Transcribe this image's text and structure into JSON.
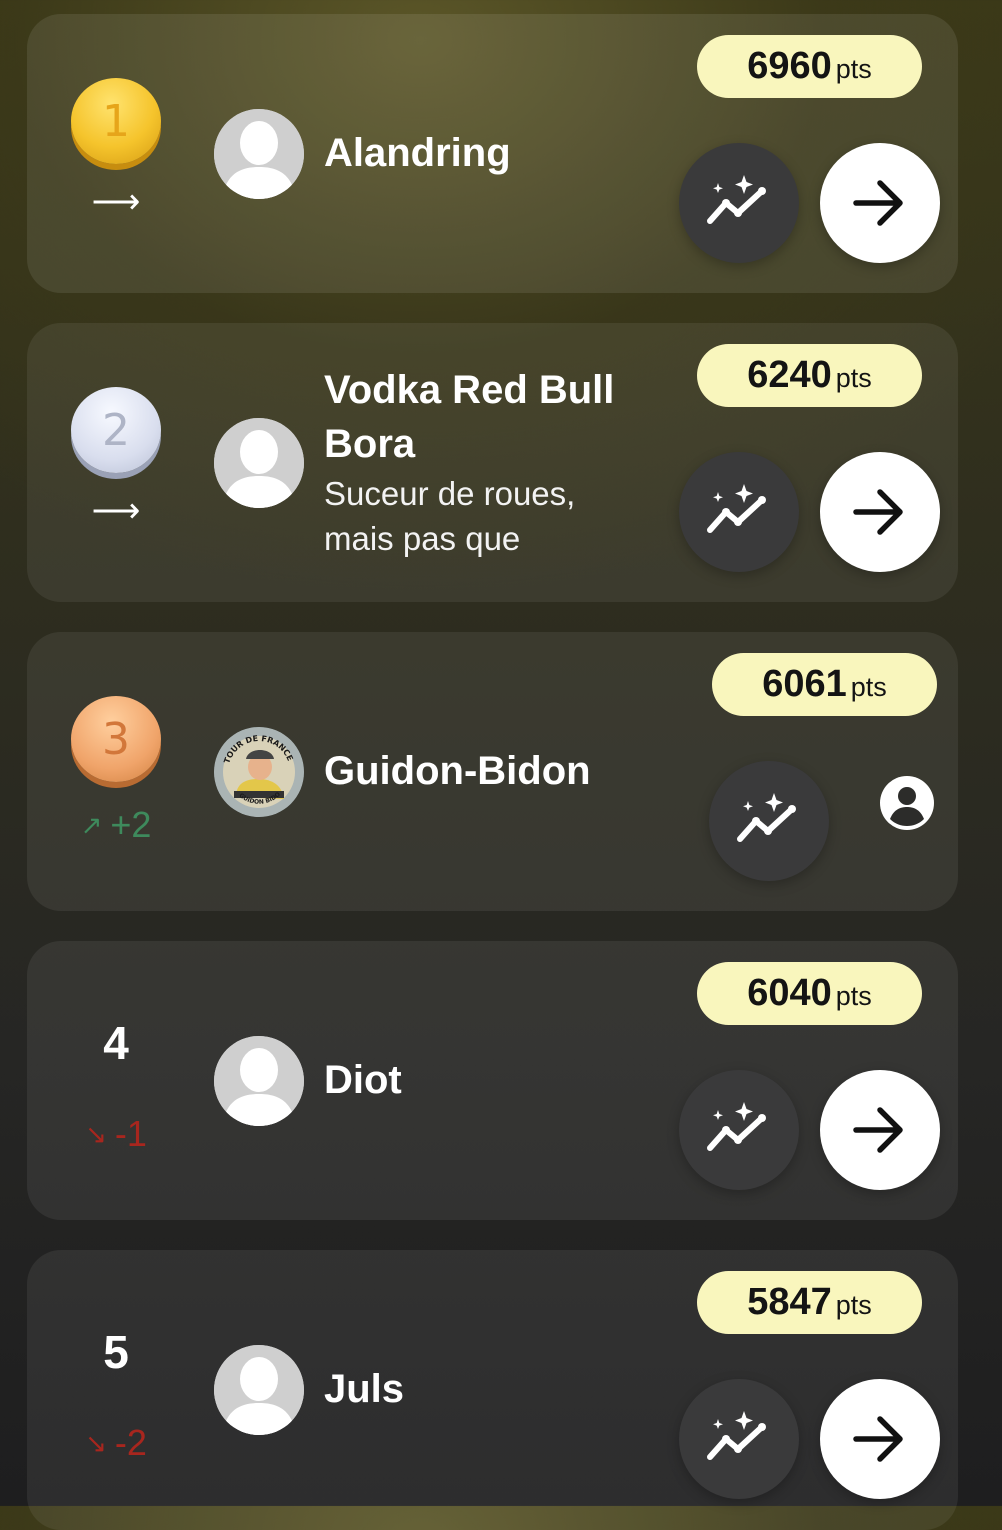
{
  "leaderboard": [
    {
      "rank": "1",
      "medal": "gold",
      "trend_arrow": "⟶",
      "trend_text": "",
      "trend_type": "same",
      "name_line1": "Alandring",
      "name_line2": "",
      "subtitle_line1": "",
      "subtitle_line2": "",
      "points": "6960",
      "points_unit": "pts",
      "avatar": "default-avatar",
      "action": "arrow-right-icon"
    },
    {
      "rank": "2",
      "medal": "silver",
      "trend_arrow": "⟶",
      "trend_text": "",
      "trend_type": "same",
      "name_line1": "Vodka Red Bull",
      "name_line2": "Bora",
      "subtitle_line1": "Suceur de roues,",
      "subtitle_line2": "mais pas que",
      "points": "6240",
      "points_unit": "pts",
      "avatar": "default-avatar",
      "action": "arrow-right-icon"
    },
    {
      "rank": "3",
      "medal": "bronze",
      "trend_arrow": "↗",
      "trend_text": "+2",
      "trend_type": "up",
      "name_line1": "Guidon-Bidon",
      "name_line2": "",
      "subtitle_line1": "",
      "subtitle_line2": "",
      "points": "6061",
      "points_unit": "pts",
      "avatar": "custom-cyclist-avatar",
      "avatar_text_top": "TOUR DE FRANCE",
      "avatar_text_bottom": "GUIDON BIDON",
      "action": "user-profile-icon"
    },
    {
      "rank": "4",
      "medal": "",
      "trend_arrow": "↘",
      "trend_text": "-1",
      "trend_type": "down",
      "name_line1": "Diot",
      "name_line2": "",
      "subtitle_line1": "",
      "subtitle_line2": "",
      "points": "6040",
      "points_unit": "pts",
      "avatar": "default-avatar",
      "action": "arrow-right-icon"
    },
    {
      "rank": "5",
      "medal": "",
      "trend_arrow": "↘",
      "trend_text": "-2",
      "trend_type": "down",
      "name_line1": "Juls",
      "name_line2": "",
      "subtitle_line1": "",
      "subtitle_line2": "",
      "points": "5847",
      "points_unit": "pts",
      "avatar": "default-avatar",
      "action": "arrow-right-icon"
    }
  ],
  "colors": {
    "points_badge": "#f9f6bd",
    "trend_up": "#3e8a5c",
    "trend_down": "#a8261e",
    "stats_button": "#3a3a3b"
  }
}
